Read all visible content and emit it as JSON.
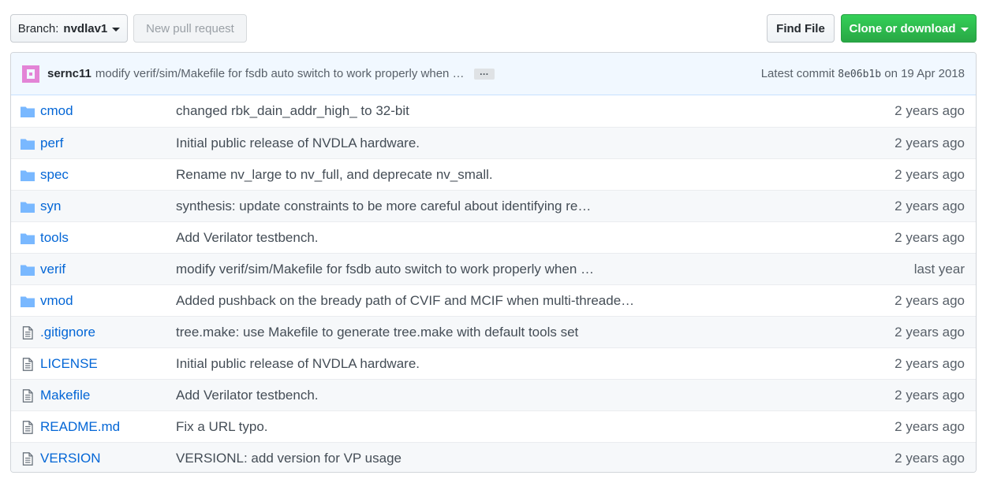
{
  "toolbar": {
    "branch_prefix": "Branch:",
    "branch_name": "nvdlav1",
    "new_pr_label": "New pull request",
    "find_file_label": "Find File",
    "clone_label": "Clone or download"
  },
  "commit": {
    "author": "sernc11",
    "message": "modify verif/sim/Makefile for fsdb auto switch to work properly when …",
    "ellipsis": "…",
    "latest_prefix": "Latest commit",
    "sha": "8e06b1b",
    "date": "on 19 Apr 2018"
  },
  "colors": {
    "link": "#0366d6",
    "folder_icon": "#79b8ff",
    "clone_green": "#28a745",
    "avatar_pink": "#e384d6"
  },
  "files": [
    {
      "type": "folder",
      "icon": "folder-icon",
      "name": "cmod",
      "message": "changed rbk_dain_addr_high_ to 32-bit",
      "age": "2 years ago"
    },
    {
      "type": "folder",
      "icon": "folder-icon",
      "name": "perf",
      "message": "Initial public release of NVDLA hardware.",
      "age": "2 years ago"
    },
    {
      "type": "folder",
      "icon": "folder-icon",
      "name": "spec",
      "message": "Rename nv_large to nv_full, and deprecate nv_small.",
      "age": "2 years ago"
    },
    {
      "type": "folder",
      "icon": "folder-icon",
      "name": "syn",
      "message": "synthesis: update constraints to be more careful about identifying re…",
      "age": "2 years ago"
    },
    {
      "type": "folder",
      "icon": "folder-icon",
      "name": "tools",
      "message": "Add Verilator testbench.",
      "age": "2 years ago"
    },
    {
      "type": "folder",
      "icon": "folder-icon",
      "name": "verif",
      "message": "modify verif/sim/Makefile for fsdb auto switch to work properly when …",
      "age": "last year"
    },
    {
      "type": "folder",
      "icon": "folder-icon",
      "name": "vmod",
      "message": "Added pushback on the bready path of CVIF and MCIF when multi-threade…",
      "age": "2 years ago"
    },
    {
      "type": "file",
      "icon": "file-icon",
      "name": ".gitignore",
      "message": "tree.make: use Makefile to generate tree.make with default tools set",
      "age": "2 years ago"
    },
    {
      "type": "file",
      "icon": "file-icon",
      "name": "LICENSE",
      "message": "Initial public release of NVDLA hardware.",
      "age": "2 years ago"
    },
    {
      "type": "file",
      "icon": "file-icon",
      "name": "Makefile",
      "message": "Add Verilator testbench.",
      "age": "2 years ago"
    },
    {
      "type": "file",
      "icon": "file-icon",
      "name": "README.md",
      "message": "Fix a URL typo.",
      "age": "2 years ago"
    },
    {
      "type": "file",
      "icon": "file-icon",
      "name": "VERSION",
      "message": "VERSIONL: add version for VP usage",
      "age": "2 years ago"
    }
  ]
}
